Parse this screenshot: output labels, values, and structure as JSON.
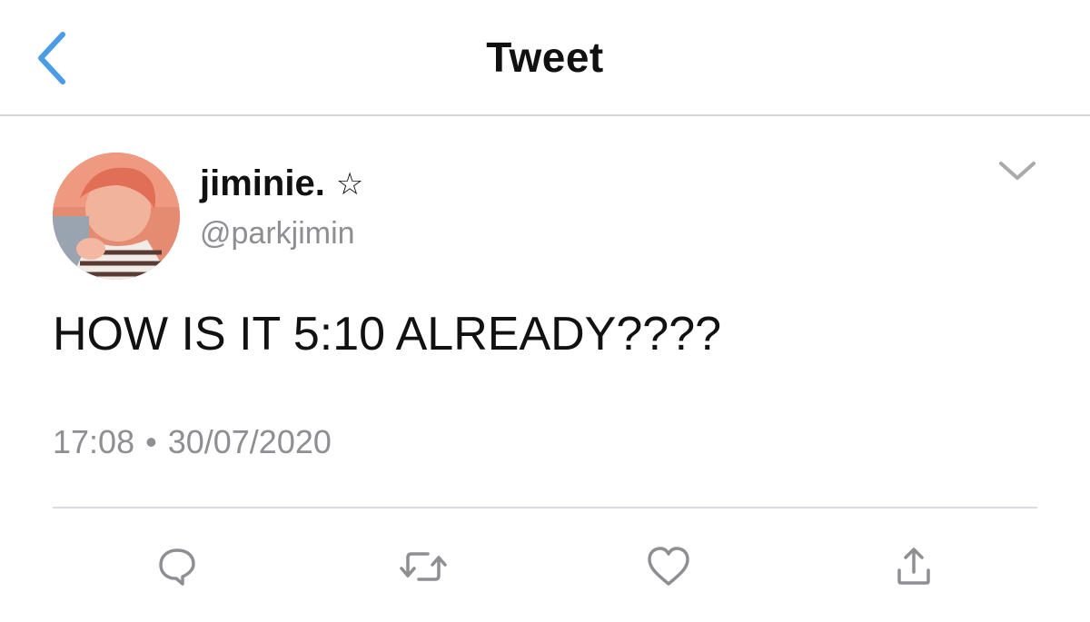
{
  "nav": {
    "title": "Tweet",
    "back_icon": "chevron-left-icon",
    "accent_color": "#4a9be8"
  },
  "tweet": {
    "display_name": "jiminie.",
    "name_emoji": "☆",
    "handle": "@parkjimin",
    "text": "HOW IS IT 5:10 ALREADY????",
    "time": "17:08",
    "separator": "•",
    "date": "30/07/2020"
  },
  "actions": [
    {
      "name": "reply",
      "icon": "reply-bubble-icon"
    },
    {
      "name": "retweet",
      "icon": "retweet-icon"
    },
    {
      "name": "like",
      "icon": "heart-icon"
    },
    {
      "name": "share",
      "icon": "share-icon"
    }
  ],
  "colors": {
    "text": "#111111",
    "secondary": "#8e8e93",
    "icon": "#8e8e93",
    "divider": "#dcdce0"
  }
}
